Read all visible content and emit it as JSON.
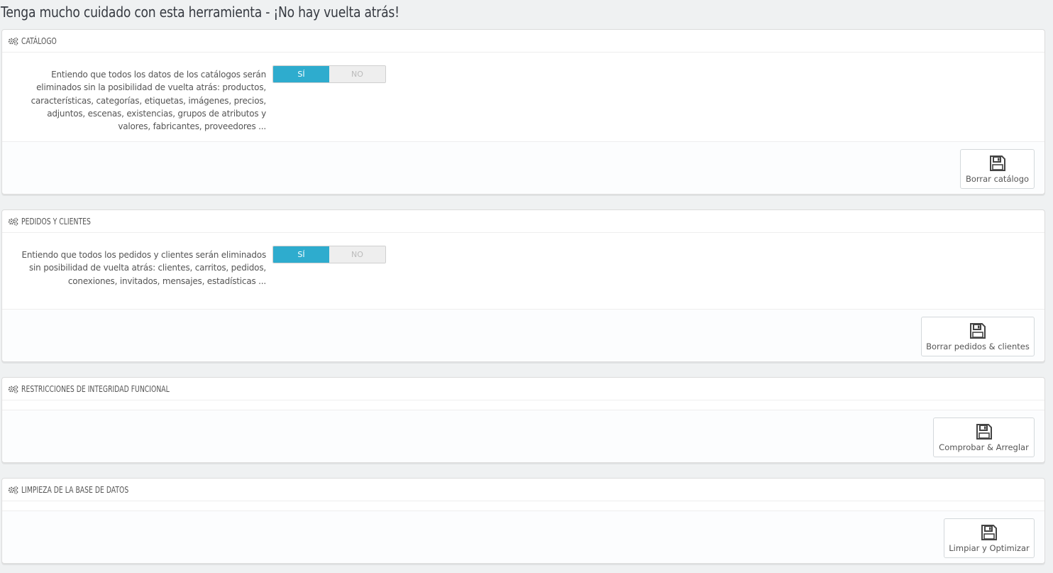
{
  "page": {
    "title": "Tenga mucho cuidado con esta herramienta - ¡No hay vuelta atrás!"
  },
  "colors": {
    "switch_on": "#2eacce",
    "switch_off": "#eeeeee",
    "background": "#eff1f2"
  },
  "panels": [
    {
      "heading": "CATÁLOGO",
      "icon": "cogs-icon",
      "description": "Entiendo que todos los datos de los catálogos serán eliminados sin la posibilidad de vuelta atrás: productos, características, categorías, etiquetas, imágenes, precios, adjuntos, escenas, existencias, grupos de atributos y valores, fabricantes, proveedores ...",
      "switch": {
        "yes": "SÍ",
        "no": "NO",
        "selected": "SÍ"
      },
      "button_label": "Borrar catálogo",
      "button_icon": "floppy-disk-icon"
    },
    {
      "heading": "PEDIDOS Y CLIENTES",
      "icon": "cogs-icon",
      "description": "Entiendo que todos los pedidos y clientes serán eliminados sin posibilidad de vuelta atrás: clientes, carritos, pedidos, conexiones, invitados, mensajes, estadísticas ...",
      "switch": {
        "yes": "SÍ",
        "no": "NO",
        "selected": "SÍ"
      },
      "button_label": "Borrar pedidos & clientes",
      "button_icon": "floppy-disk-icon"
    },
    {
      "heading": "RESTRICCIONES DE INTEGRIDAD FUNCIONAL",
      "icon": "cogs-icon",
      "button_label": "Comprobar & Arreglar",
      "button_icon": "floppy-disk-icon"
    },
    {
      "heading": "LIMPIEZA DE LA BASE DE DATOS",
      "icon": "cogs-icon",
      "button_label": "Limpiar y Optimizar",
      "button_icon": "floppy-disk-icon"
    }
  ]
}
